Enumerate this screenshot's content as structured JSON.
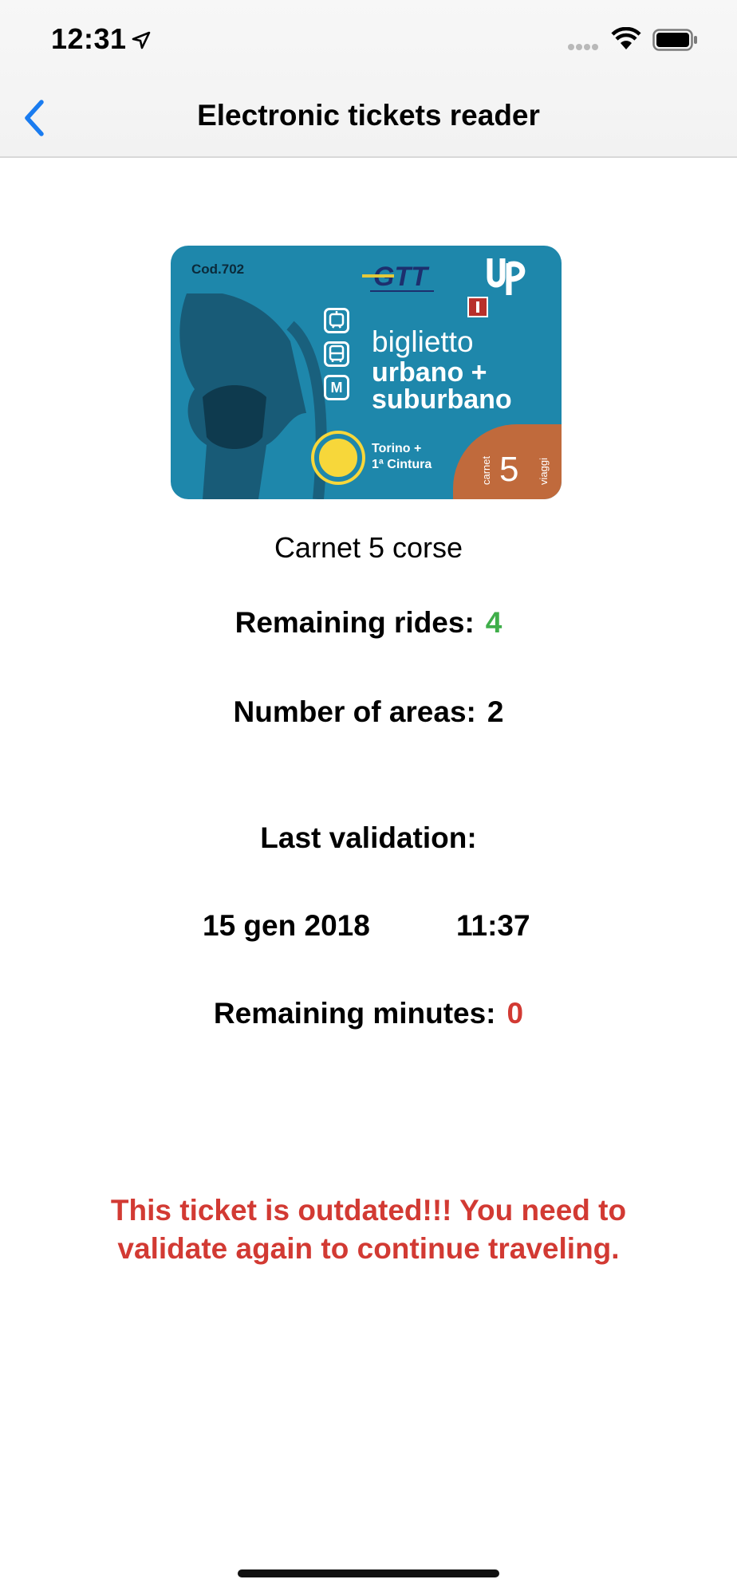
{
  "status_bar": {
    "time": "12:31"
  },
  "nav": {
    "title": "Electronic tickets reader",
    "back_icon": "chevron-left-icon"
  },
  "ticket_card": {
    "code": "Cod.702",
    "brand": "GTT",
    "line1": "biglietto",
    "line2": "urbano +",
    "line3": "suburbano",
    "zone1": "Torino +",
    "zone2": "1ª Cintura",
    "corner_number": "5",
    "corner_label1": "carnet",
    "corner_label2": "viaggi",
    "mode_icons": [
      "tram-icon",
      "bus-icon",
      "metro-icon"
    ],
    "metro_letter": "M"
  },
  "ticket_name": "Carnet 5 corse",
  "remaining_rides": {
    "label": "Remaining rides:",
    "value": "4"
  },
  "areas": {
    "label": "Number of areas:",
    "value": "2"
  },
  "last_validation": {
    "label": "Last validation:",
    "date": "15 gen 2018",
    "time": "11:37"
  },
  "remaining_minutes": {
    "label": "Remaining minutes:",
    "value": "0"
  },
  "warning": {
    "line1": "This ticket is outdated!!! You need to",
    "line2": "validate again to continue traveling."
  },
  "colors": {
    "accent": "#1a7cf0",
    "positive": "#3fae4a",
    "alert": "#d23a33",
    "card": "#1e87ab"
  }
}
